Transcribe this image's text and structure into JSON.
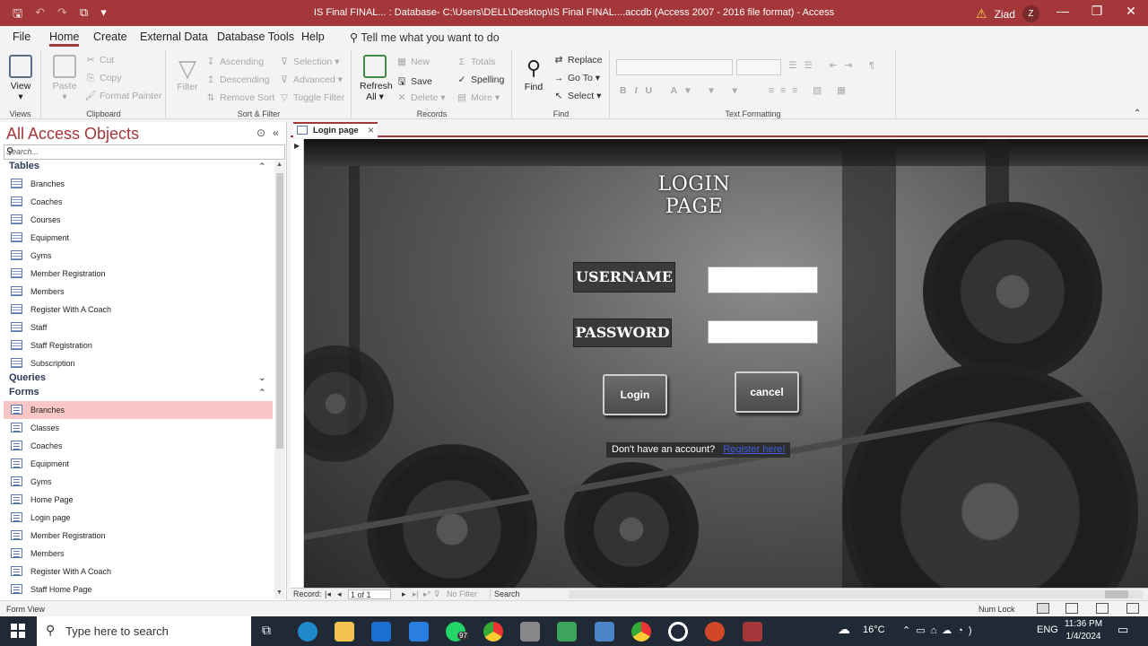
{
  "window": {
    "title": "IS Final FINAL... : Database- C:\\Users\\DELL\\Desktop\\IS Final FINAL....accdb (Access 2007 - 2016 file format) - Access",
    "user_name": "Ziad",
    "user_initial": "Z"
  },
  "menu": {
    "tabs": [
      "File",
      "Home",
      "Create",
      "External Data",
      "Database Tools",
      "Help"
    ],
    "active": "Home",
    "tell_me": "Tell me what you want to do"
  },
  "ribbon": {
    "views": {
      "view": "View",
      "group": "Views"
    },
    "clipboard": {
      "paste": "Paste",
      "cut": "Cut",
      "copy": "Copy",
      "format_painter": "Format Painter",
      "group": "Clipboard"
    },
    "sort_filter": {
      "filter": "Filter",
      "ascending": "Ascending",
      "descending": "Descending",
      "remove_sort": "Remove Sort",
      "selection": "Selection",
      "advanced": "Advanced",
      "toggle_filter": "Toggle Filter",
      "group": "Sort & Filter"
    },
    "records": {
      "refresh": "Refresh",
      "refresh_all": "All",
      "new": "New",
      "save": "Save",
      "delete": "Delete",
      "totals": "Totals",
      "spelling": "Spelling",
      "more": "More",
      "group": "Records"
    },
    "find": {
      "find": "Find",
      "replace": "Replace",
      "go_to": "Go To",
      "select": "Select",
      "group": "Find"
    },
    "text_formatting": {
      "group": "Text Formatting"
    }
  },
  "nav": {
    "title": "All Access Objects",
    "search_placeholder": "Search...",
    "sections": [
      {
        "name": "Tables",
        "kind": "table",
        "items": [
          "Branches",
          "Coaches",
          "Courses",
          "Equipment",
          "Gyms",
          "Member Registration",
          "Members",
          "Register With A Coach",
          "Staff",
          "Staff Registration",
          "Subscription"
        ]
      },
      {
        "name": "Queries",
        "kind": "query",
        "items": []
      },
      {
        "name": "Forms",
        "kind": "form",
        "selected": "Branches",
        "items": [
          "Branches",
          "Classes",
          "Coaches",
          "Equipment",
          "Gyms",
          "Home Page",
          "Login page",
          "Member Registration",
          "Members",
          "Register With A Coach",
          "Staff Home Page"
        ]
      }
    ]
  },
  "doc_tab": {
    "label": "Login page"
  },
  "form": {
    "title": "LOGIN PAGE",
    "username_label": "USERNAME",
    "password_label": "PASSWORD",
    "username_value": "",
    "password_value": "",
    "login_button": "Login",
    "cancel_button": "cancel",
    "no_account": "Don't have an account?",
    "register_link": "Register here!"
  },
  "record_nav": {
    "record_label": "Record:",
    "position": "1 of 1",
    "filter": "No Filter",
    "search": "Search"
  },
  "status": {
    "mode": "Form View",
    "num_lock": "Num Lock"
  },
  "taskbar": {
    "search_placeholder": "Type here to search",
    "whatsapp_badge": "97",
    "temperature": "16°C",
    "language": "ENG",
    "time": "11:36 PM",
    "date": "1/4/2024"
  }
}
